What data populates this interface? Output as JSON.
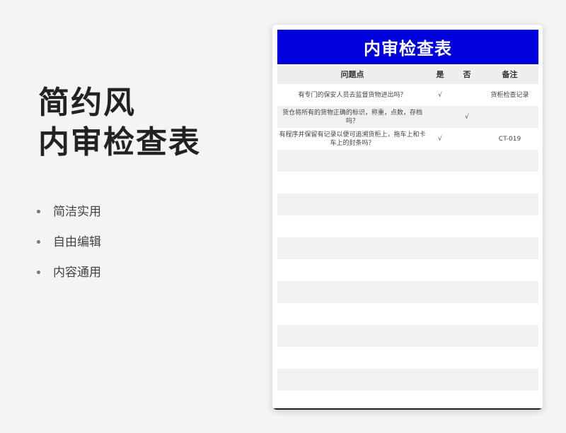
{
  "promo": {
    "title_line1": "简约风",
    "title_line2": "内审检查表",
    "features": [
      "简洁实用",
      "自由编辑",
      "内容通用"
    ]
  },
  "sheet": {
    "title": "内审检查表",
    "title_bg": "#0000dd",
    "headers": {
      "question": "问题点",
      "yes": "是",
      "no": "否",
      "note": "备注"
    },
    "rows": [
      {
        "question": "有专门的保安人员去监督货物进出吗？",
        "yes": "√",
        "no": "",
        "note": "货柜检查记录"
      },
      {
        "question": "货仓将所有的货物正确的标识，称重，点数，存档吗？",
        "yes": "",
        "no": "√",
        "note": ""
      },
      {
        "question": "有程序并保留有记录以便可追溯货柜上，拖车上和卡车上的封条吗？",
        "yes": "√",
        "no": "",
        "note": "CT-019"
      }
    ]
  }
}
